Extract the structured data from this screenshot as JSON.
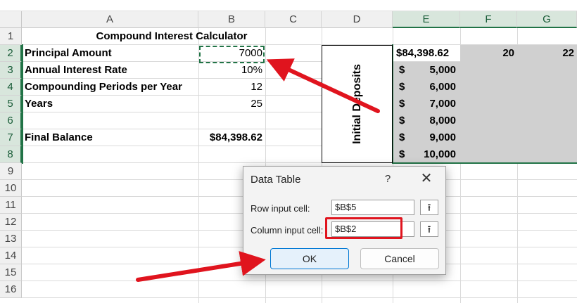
{
  "sheet": {
    "columns": [
      "A",
      "B",
      "C",
      "D",
      "E",
      "F",
      "G"
    ],
    "rows": [
      "1",
      "2",
      "3",
      "4",
      "5",
      "6",
      "7",
      "8",
      "9",
      "10",
      "11",
      "12",
      "13",
      "14",
      "15",
      "16"
    ],
    "title": "Compound Interest Calculator",
    "labels": {
      "principal": "Principal Amount",
      "rate": "Annual Interest Rate",
      "periods": "Compounding Periods per Year",
      "years": "Years",
      "final": "Final Balance"
    },
    "values": {
      "principal": "7000",
      "rate": "10%",
      "periods": "12",
      "years": "25",
      "final": "$84,398.62"
    },
    "initial_deposits_label": "Initial Deposits",
    "table_corner": "$84,398.62",
    "row_header_values": [
      "20",
      "22"
    ],
    "currency_symbol": "$",
    "deposits": [
      "5,000",
      "6,000",
      "7,000",
      "8,000",
      "9,000",
      "10,000"
    ]
  },
  "dialog": {
    "title": "Data Table",
    "help_glyph": "?",
    "close_glyph": "✕",
    "row_input_label": "Row input cell:",
    "row_input_value": "$B$5",
    "column_input_label": "Column input cell:",
    "column_input_value": "$B$2",
    "collapse_glyph": "⭱",
    "ok_label": "OK",
    "cancel_label": "Cancel"
  },
  "colors": {
    "excel_green": "#217346",
    "highlight_red": "#e0141e",
    "selection_gray": "#d0d0d0",
    "ok_button_border": "#0078d4"
  }
}
